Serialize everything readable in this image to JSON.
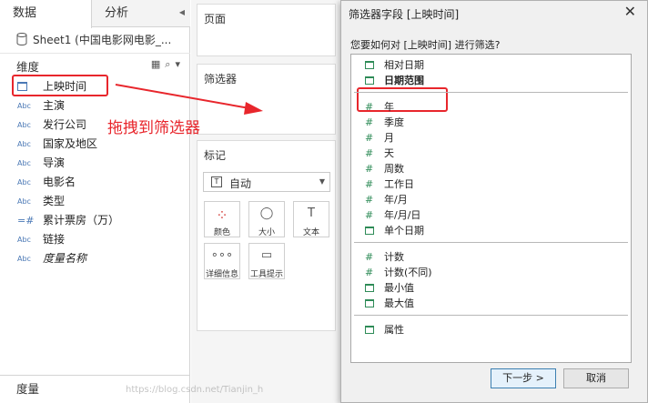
{
  "data_pane": {
    "tabs": [
      {
        "label": "数据"
      },
      {
        "label": "分析"
      }
    ],
    "source": "Sheet1 (中国电影网电影_...",
    "dimensions_title": "维度",
    "dimensions": [
      {
        "label": "上映时间",
        "type": "date"
      },
      {
        "label": "主演",
        "type": "Abc"
      },
      {
        "label": "发行公司",
        "type": "Abc"
      },
      {
        "label": "国家及地区",
        "type": "Abc"
      },
      {
        "label": "导演",
        "type": "Abc"
      },
      {
        "label": "电影名",
        "type": "Abc"
      },
      {
        "label": "类型",
        "type": "Abc"
      },
      {
        "label": "累计票房（万）",
        "type": "number"
      },
      {
        "label": "链接",
        "type": "Abc"
      },
      {
        "label": "度量名称",
        "type": "Abc"
      }
    ],
    "measures_title": "度量",
    "type_text": "Abc"
  },
  "shelves": {
    "pages_title": "页面",
    "filters_title": "筛选器",
    "marks_title": "标记",
    "mark_type": "自动",
    "mark_buttons": [
      {
        "label": "颜色",
        "icon": "color-dots-icon"
      },
      {
        "label": "大小",
        "icon": "size-icon"
      },
      {
        "label": "文本",
        "icon": "text-icon"
      },
      {
        "label": "详细信息",
        "icon": "detail-icon"
      },
      {
        "label": "工具提示",
        "icon": "tooltip-icon"
      }
    ]
  },
  "annotation": {
    "text": "拖拽到筛选器",
    "color": "#e8262c"
  },
  "dialog": {
    "title": "筛选器字段 [上映时间]",
    "question": "您要如何对 [上映时间] 进行筛选?",
    "groups": [
      [
        {
          "label": "相对日期",
          "icon": "calendar",
          "bold": false
        },
        {
          "label": "日期范围",
          "icon": "calendar",
          "bold": true
        }
      ],
      [
        {
          "label": "年",
          "icon": "hash",
          "bold": false
        },
        {
          "label": "季度",
          "icon": "hash",
          "bold": false
        },
        {
          "label": "月",
          "icon": "hash",
          "bold": false
        },
        {
          "label": "天",
          "icon": "hash",
          "bold": false
        },
        {
          "label": "周数",
          "icon": "hash",
          "bold": false
        },
        {
          "label": "工作日",
          "icon": "hash",
          "bold": false
        },
        {
          "label": "年/月",
          "icon": "hash",
          "bold": false
        },
        {
          "label": "年/月/日",
          "icon": "hash",
          "bold": false
        },
        {
          "label": "单个日期",
          "icon": "calendar",
          "bold": false
        }
      ],
      [
        {
          "label": "计数",
          "icon": "hash",
          "bold": false
        },
        {
          "label": "计数(不同)",
          "icon": "hash",
          "bold": false
        },
        {
          "label": "最小值",
          "icon": "calendar",
          "bold": false
        },
        {
          "label": "最大值",
          "icon": "calendar",
          "bold": false
        }
      ],
      [
        {
          "label": "属性",
          "icon": "calendar",
          "bold": false
        }
      ]
    ],
    "next_button": "下一步 >",
    "cancel_button": "取消"
  },
  "watermark": "https://blog.csdn.net/Tianjin_h",
  "colors": {
    "highlight": "#e8262c",
    "date_icon": "#2e8b57",
    "dim_icon": "#4a78b5"
  }
}
